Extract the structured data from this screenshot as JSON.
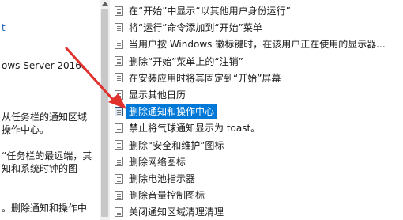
{
  "description": {
    "link_text": "t",
    "lines": [
      "ows Server 2016、",
      "从任务栏的通知区域",
      "操作中心。",
      "“任务栏的最远端，其",
      "知和系统时钟的图",
      "。删除通知和操作中"
    ]
  },
  "policies": [
    "在“开始”中显示“以其他用户身份运行”",
    "将“运行”命令添加到“开始”菜单",
    "当用户按 Windows 徽标键时，在该用户正在使用的显示器...",
    "删除“开始”菜单上的“注销”",
    "在安装应用时将其固定到“开始”屏幕",
    "显示其他日历",
    "删除通知和操作中心",
    "禁止将气球通知显示为 toast。",
    "删除“安全和维护”图标",
    "删除网络图标",
    "删除电池指示器",
    "删除音量控制图标",
    "关闭通知区域清理清理"
  ],
  "selected_index": 6,
  "annotation_color": "#e0312d",
  "selection_color": "#0078d7"
}
